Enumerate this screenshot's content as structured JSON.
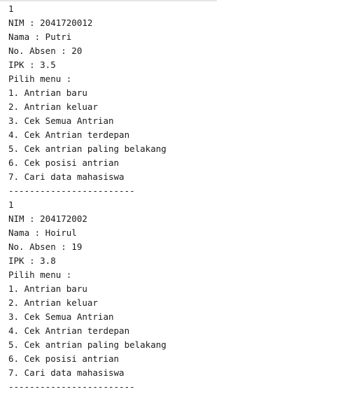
{
  "console": {
    "lines": [
      "1",
      "NIM : 2041720012",
      "Nama : Putri",
      "No. Absen : 20",
      "IPK : 3.5",
      "Pilih menu :",
      "1. Antrian baru",
      "2. Antrian keluar",
      "3. Cek Semua Antrian",
      "4. Cek Antrian terdepan",
      "5. Cek antrian paling belakang",
      "6. Cek posisi antrian",
      "7. Cari data mahasiswa",
      "------------------------",
      "1",
      "NIM : 204172002",
      "Nama : Hoirul",
      "No. Absen : 19",
      "IPK : 3.8",
      "Pilih menu :",
      "1. Antrian baru",
      "2. Antrian keluar",
      "3. Cek Semua Antrian",
      "4. Cek Antrian terdepan",
      "5. Cek antrian paling belakang",
      "6. Cek posisi antrian",
      "7. Cari data mahasiswa",
      "------------------------"
    ]
  }
}
